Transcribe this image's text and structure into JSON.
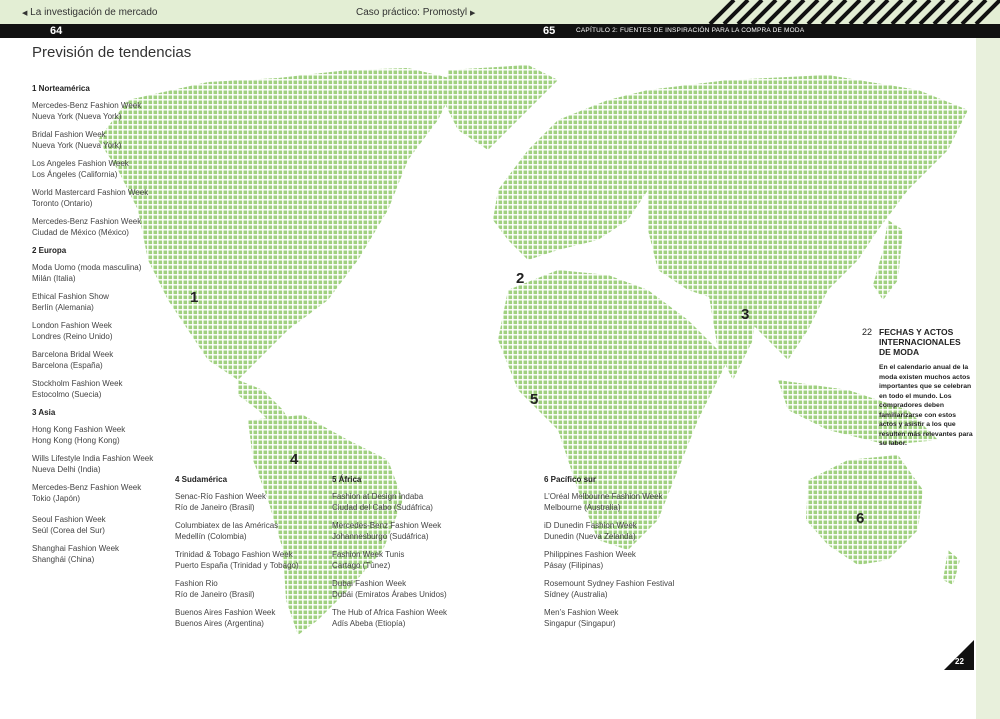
{
  "header": {
    "left_link": "La investigación de mercado",
    "center_link": "Caso práctico: Promostyl",
    "page_left": "64",
    "page_right": "65",
    "chapter": "CAPÍTULO 2: FUENTES DE INSPIRACIÓN PARA LA COMPRA DE MODA"
  },
  "title": "Previsión de tendencias",
  "regions": [
    {
      "heading": "1 Norteamérica",
      "events": [
        {
          "name": "Mercedes-Benz Fashion Week",
          "place": "Nueva York (Nueva York)"
        },
        {
          "name": "Bridal Fashion Week",
          "place": "Nueva York (Nueva York)"
        },
        {
          "name": "Los Angeles Fashion Week",
          "place": "Los Ángeles (California)"
        },
        {
          "name": "World Mastercard Fashion Week",
          "place": "Toronto (Ontario)"
        },
        {
          "name": "Mercedes-Benz Fashion Week",
          "place": "Ciudad de México (México)"
        }
      ]
    },
    {
      "heading": "2 Europa",
      "events": [
        {
          "name": "Moda Uomo (moda masculina)",
          "place": "Milán (Italia)"
        },
        {
          "name": "Ethical Fashion Show",
          "place": "Berlín (Alemania)"
        },
        {
          "name": "London Fashion Week",
          "place": "Londres (Reino Unido)"
        },
        {
          "name": "Barcelona Bridal Week",
          "place": "Barcelona (España)"
        },
        {
          "name": "Stockholm Fashion Week",
          "place": "Estocolmo (Suecia)"
        }
      ]
    },
    {
      "heading": "3 Asia",
      "events": [
        {
          "name": "Hong Kong Fashion Week",
          "place": "Hong Kong (Hong Kong)"
        },
        {
          "name": "Wills Lifestyle India Fashion Week",
          "place": "Nueva Delhi (India)"
        },
        {
          "name": "Mercedes-Benz Fashion Week",
          "place": "Tokio (Japón)"
        },
        {
          "name": "Seoul Fashion Week",
          "place": "Seúl (Corea del Sur)"
        },
        {
          "name": "Shanghai Fashion Week",
          "place": "Shanghái (China)"
        }
      ]
    },
    {
      "heading": "4 Sudamérica",
      "events": [
        {
          "name": "Senac-Río Fashion Week",
          "place": "Río de Janeiro (Brasil)"
        },
        {
          "name": "Columbiatex de las Américas",
          "place": "Medellín (Colombia)"
        },
        {
          "name": "Trinidad & Tobago Fashion Week",
          "place": "Puerto España (Trinidad y Tobago)"
        },
        {
          "name": "Fashion Rio",
          "place": "Río de Janeiro (Brasil)"
        },
        {
          "name": "Buenos Aires Fashion Week",
          "place": "Buenos Aires (Argentina)"
        }
      ]
    },
    {
      "heading": "5 África",
      "events": [
        {
          "name": "Fashion at Design Indaba",
          "place": "Ciudad del Cabo (Sudáfrica)"
        },
        {
          "name": "Mercedes-Benz Fashion Week",
          "place": "Johannesburgo (Sudáfrica)"
        },
        {
          "name": "Fashion Week Tunis",
          "place": "Cartago (Túnez)"
        },
        {
          "name": "Dubai Fashion Week",
          "place": "Dubái (Emiratos Árabes Unidos)"
        },
        {
          "name": "The Hub of Africa Fashion Week",
          "place": "Adís Abeba (Etiopía)"
        }
      ]
    },
    {
      "heading": "6 Pacífico sur",
      "events": [
        {
          "name": "L’Oréal Melbourne Fashion Week",
          "place": "Melbourne (Australia)"
        },
        {
          "name": "iD Dunedin Fashion Week",
          "place": "Dunedin (Nueva Zelanda)"
        },
        {
          "name": "Philippines Fashion Week",
          "place": "Pásay (Filipinas)"
        },
        {
          "name": "Rosemount Sydney Fashion Festival",
          "place": "Sídney (Australia)"
        },
        {
          "name": "Men’s Fashion Week",
          "place": "Singapur (Singapur)"
        }
      ]
    }
  ],
  "map_labels": [
    "1",
    "2",
    "3",
    "4",
    "5",
    "6"
  ],
  "note": {
    "number": "22",
    "title": "FECHAS Y ACTOS INTERNACIONALES DE MODA",
    "body": "En el calendario anual de la moda existen muchos actos importantes que se celebran en todo el mundo. Los compradores deben familiarizarse con estos actos y asistir a los que resulten más relevantes para su labor."
  },
  "corner_page": "22",
  "colors": {
    "map_green": "#9fd07f",
    "header_black": "#111111",
    "accent_light": "#e3eed4"
  }
}
